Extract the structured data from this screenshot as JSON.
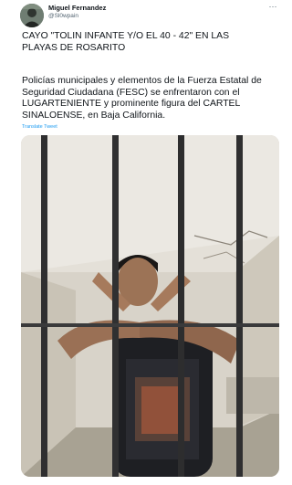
{
  "author": {
    "name": "Miguel Fernandez",
    "handle": "@Sl0wpain",
    "avatar_icon": "user-avatar"
  },
  "more_menu": {
    "icon": "more-horizontal-icon",
    "label": "···"
  },
  "tweet": {
    "headline": "CAYO \"TOLIN INFANTE Y/O EL 40 - 42\"  EN LAS\nPLAYAS DE ROSARITO",
    "body_segments": [
      {
        "text": "Policías municipales y elementos de la Fuerza Estatal de Seguridad Ciudadana (FESC) se enfrentaron con el LUGARTENIENTE y prominente figura del CARTEL SINALOENSE, en Baja California."
      }
    ],
    "translate_label": "Translate Tweet"
  },
  "media": {
    "description_icon": "photo-icon"
  },
  "colors": {
    "text": "#0f1419",
    "secondary": "#536471",
    "link": "#1d9bf0"
  }
}
